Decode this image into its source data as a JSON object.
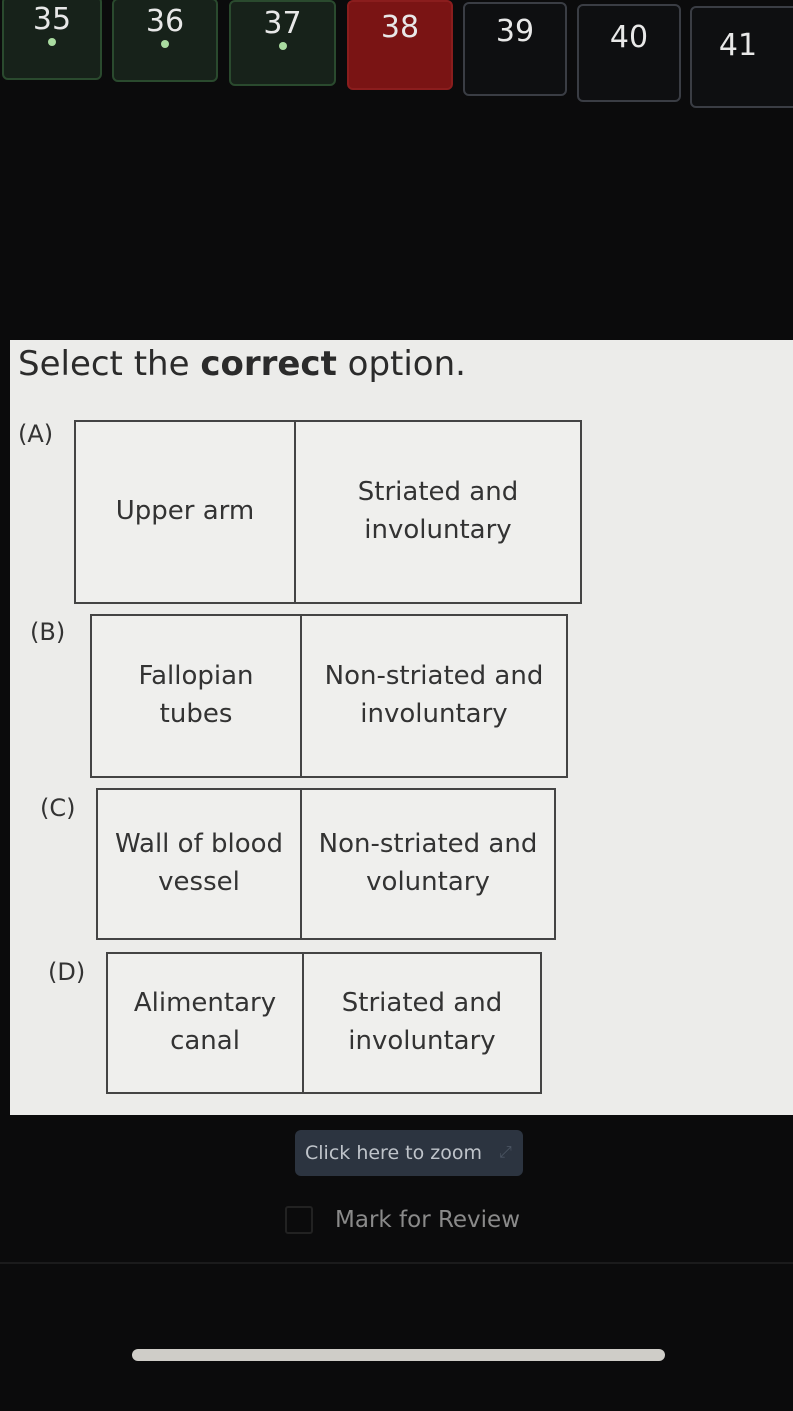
{
  "question_nav": [
    {
      "number": "35",
      "status": "answered"
    },
    {
      "number": "36",
      "status": "answered"
    },
    {
      "number": "37",
      "status": "answered"
    },
    {
      "number": "38",
      "status": "current"
    },
    {
      "number": "39",
      "status": "unvisited"
    },
    {
      "number": "40",
      "status": "unvisited"
    },
    {
      "number": "41",
      "status": "unvisited"
    }
  ],
  "question": {
    "prompt_prefix": "Select the ",
    "prompt_bold": "correct",
    "prompt_suffix": " option.",
    "options": [
      {
        "label": "(A)",
        "left": "Upper arm",
        "right": "Striated and involuntary"
      },
      {
        "label": "(B)",
        "left": "Fallopian tubes",
        "right": "Non-striated and involuntary"
      },
      {
        "label": "(C)",
        "left": "Wall of blood vessel",
        "right": "Non-striated and voluntary"
      },
      {
        "label": "(D)",
        "left": "Alimentary canal",
        "right": "Striated and involuntary"
      }
    ]
  },
  "zoom_button": {
    "label": "Click here to zoom",
    "icon": "expand-icon"
  },
  "mark_for_review": {
    "label": "Mark for Review",
    "checked": false
  },
  "colors": {
    "answered_bg": "#17221a",
    "current_bg": "#7a1414",
    "answered_dot": "#a9dca0"
  }
}
